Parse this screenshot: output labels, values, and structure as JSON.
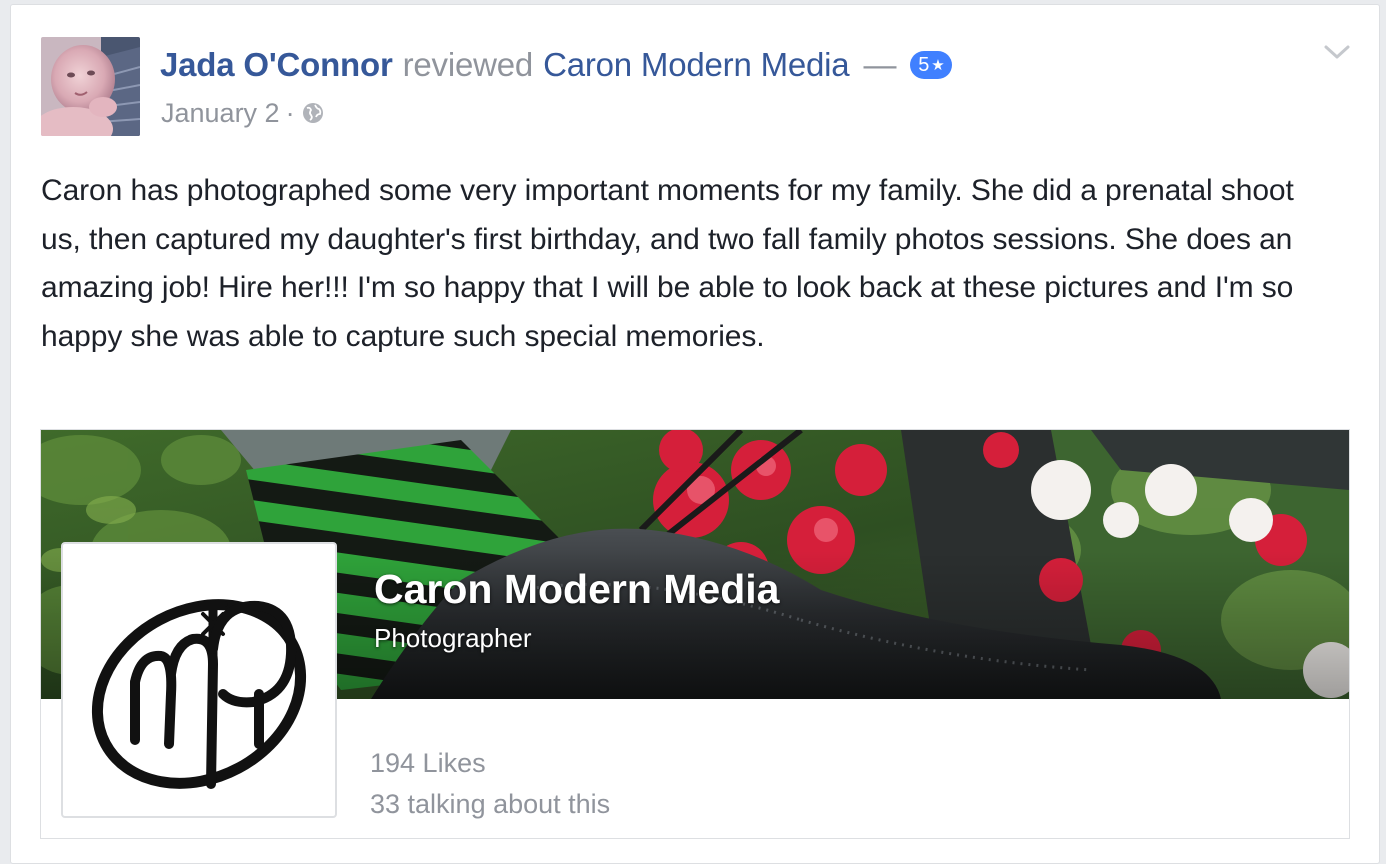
{
  "post": {
    "author": "Jada O'Connor",
    "verb": "reviewed",
    "page_link": "Caron Modern Media",
    "dash": "—",
    "rating_value": "5",
    "rating_star": "★",
    "date": "January 2",
    "separator": "·",
    "icons": {
      "avatar": "avatar",
      "audience": "globe-icon",
      "options": "chevron-down-icon"
    },
    "text": "Caron has photographed some very important moments for my family. She did a prenatal shoot us, then captured my daughter's first birthday, and two fall family photos sessions. She does an amazing job! Hire her!!! I'm so happy that I will be able to look back at these pictures and I'm so happy she was able to capture such special memories."
  },
  "attachment": {
    "page_name": "Caron Modern Media",
    "category": "Photographer",
    "likes": "194 Likes",
    "talking": "33 talking about this"
  },
  "colors": {
    "link": "#365899",
    "secondary": "#90949c",
    "badge": "#4080ff",
    "body_text": "#1d2129"
  }
}
